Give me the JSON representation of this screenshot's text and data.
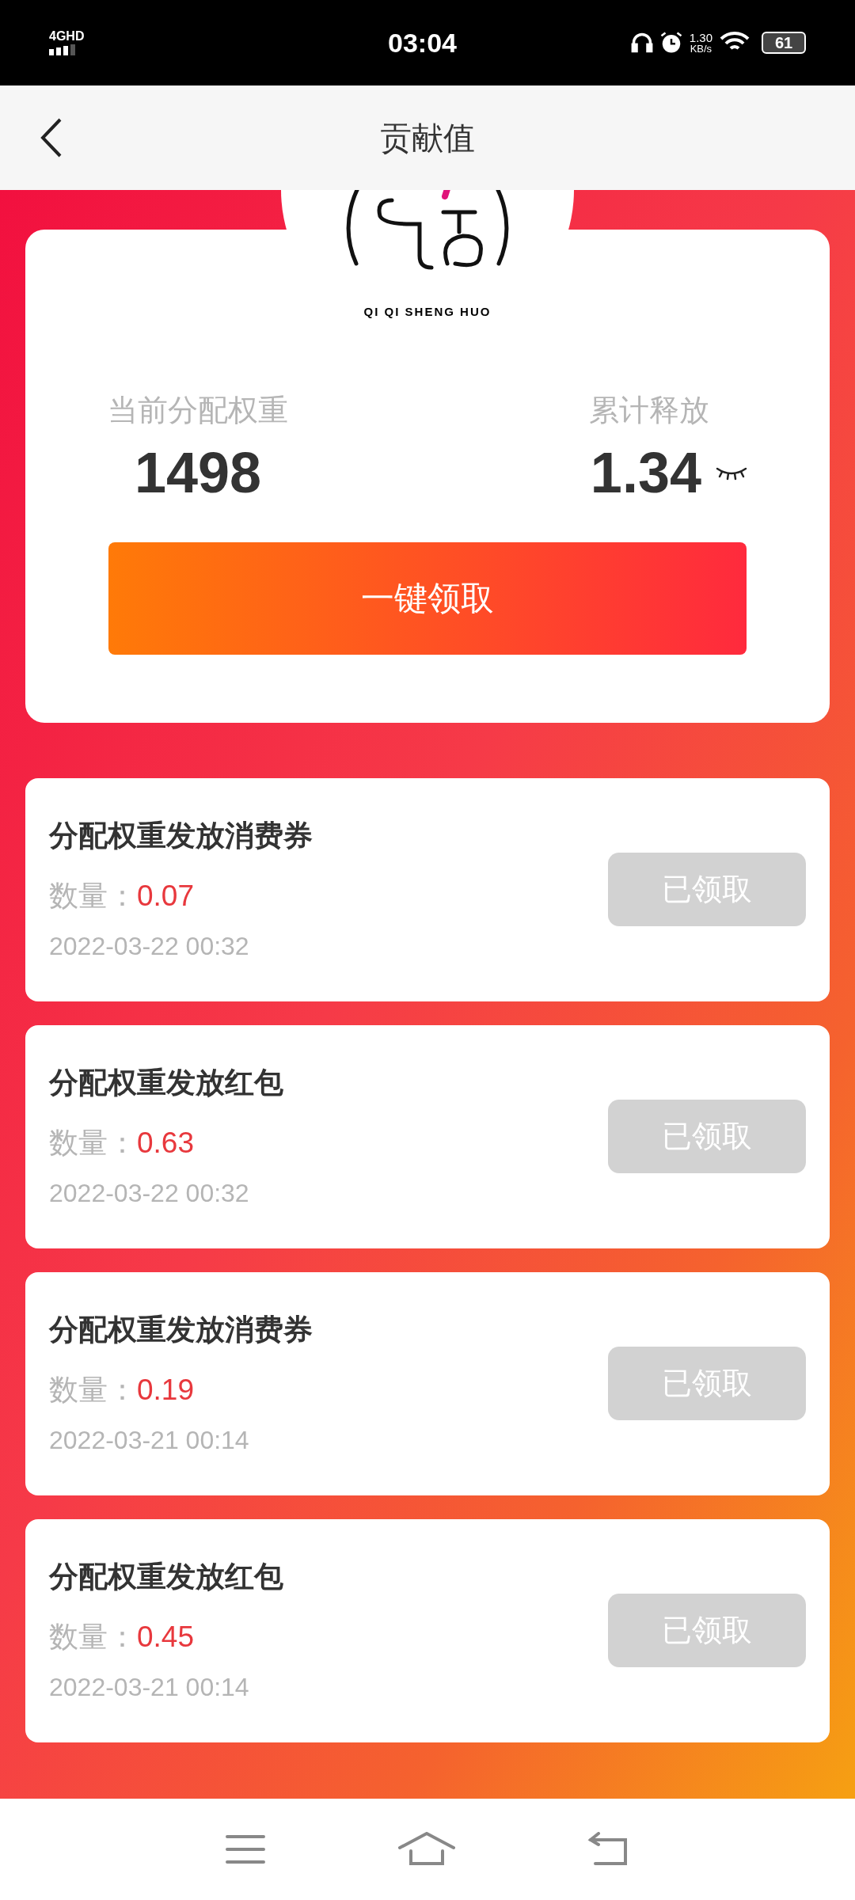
{
  "status_bar": {
    "network": "4GHD",
    "time": "03:04",
    "speed_value": "1.30",
    "speed_unit": "KB/s",
    "battery": "61"
  },
  "header": {
    "title": "贡献值"
  },
  "logo": {
    "caption": "QI QI SHENG HUO"
  },
  "summary": {
    "weight_label": "当前分配权重",
    "weight_value": "1498",
    "released_label": "累计释放",
    "released_value": "1.34",
    "claim_all_button": "一键领取"
  },
  "records": [
    {
      "title": "分配权重发放消费券",
      "amount_label": "数量：",
      "amount": "0.07",
      "date": "2022-03-22 00:32",
      "button": "已领取",
      "claimed": true
    },
    {
      "title": "分配权重发放红包",
      "amount_label": "数量：",
      "amount": "0.63",
      "date": "2022-03-22 00:32",
      "button": "已领取",
      "claimed": true
    },
    {
      "title": "分配权重发放消费券",
      "amount_label": "数量：",
      "amount": "0.19",
      "date": "2022-03-21 00:14",
      "button": "已领取",
      "claimed": true
    },
    {
      "title": "分配权重发放红包",
      "amount_label": "数量：",
      "amount": "0.45",
      "date": "2022-03-21 00:14",
      "button": "已领取",
      "claimed": true
    }
  ]
}
